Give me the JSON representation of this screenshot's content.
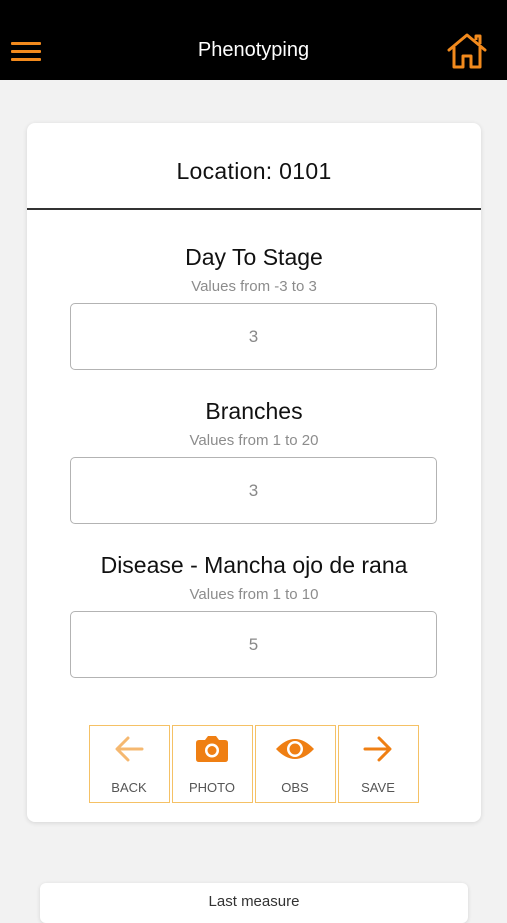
{
  "header": {
    "title": "Phenotyping",
    "menu_icon": "hamburger-menu-icon",
    "home_icon": "home-icon",
    "accent_color": "#f28a1d",
    "background_color": "#000000"
  },
  "card": {
    "location_label": "Location: 0101",
    "fields": [
      {
        "label": "Day To Stage",
        "hint": "Values from -3 to 3",
        "value": "3"
      },
      {
        "label": "Branches",
        "hint": "Values from 1 to 20",
        "value": "3"
      },
      {
        "label": "Disease - Mancha ojo de rana",
        "hint": "Values from 1 to 10",
        "value": "5"
      }
    ],
    "actions": [
      {
        "label": "BACK",
        "icon": "arrow-left-icon"
      },
      {
        "label": "PHOTO",
        "icon": "camera-icon"
      },
      {
        "label": "OBS",
        "icon": "eye-icon"
      },
      {
        "label": "SAVE",
        "icon": "arrow-right-icon"
      }
    ]
  },
  "last_panel": {
    "title": "Last measure"
  }
}
